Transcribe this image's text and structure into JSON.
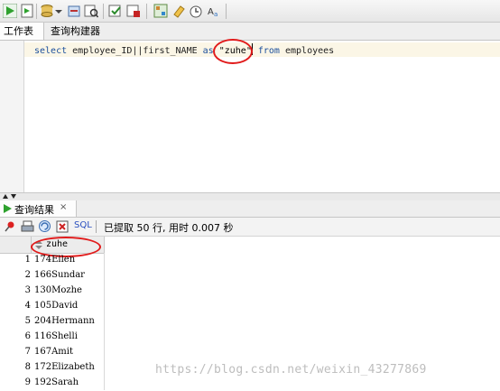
{
  "toolbar": {
    "icons": [
      "run-statement-icon",
      "run-script-icon",
      "commit-icon",
      "dropdown-arrow-icon",
      "rollback-icon",
      "explain-plan-icon",
      "autotrace-icon",
      "sql-tuning-icon",
      "unshared-sql-icon",
      "sql-history-icon",
      "eraser-icon",
      "clear-icon",
      "format-icon"
    ]
  },
  "tabs": {
    "worksheet": "工作表",
    "query_builder": "查询构建器"
  },
  "editor": {
    "kw_select": "select",
    "seg1": " employee_ID||first_NAME ",
    "kw_as": "as",
    "alias": "\"zuhe\"",
    "kw_from": "from",
    "seg2": " employees"
  },
  "results": {
    "tab_label": "查询结果",
    "tab_close": "×",
    "sql_label": "SQL",
    "status": "已提取 50 行, 用时 0.007 秒",
    "column_header": "zuhe",
    "rows": [
      {
        "num": "1",
        "value": "174Ellen"
      },
      {
        "num": "2",
        "value": "166Sundar"
      },
      {
        "num": "3",
        "value": "130Mozhe"
      },
      {
        "num": "4",
        "value": "105David"
      },
      {
        "num": "5",
        "value": "204Hermann"
      },
      {
        "num": "6",
        "value": "116Shelli"
      },
      {
        "num": "7",
        "value": "167Amit"
      },
      {
        "num": "8",
        "value": "172Elizabeth"
      },
      {
        "num": "9",
        "value": "192Sarah"
      }
    ]
  },
  "watermark": "https://blog.csdn.net/weixin_43277869",
  "colors": {
    "annotation": "#e11b1b",
    "keyword": "#1b4f9c",
    "current_line": "#fbf6e6"
  }
}
